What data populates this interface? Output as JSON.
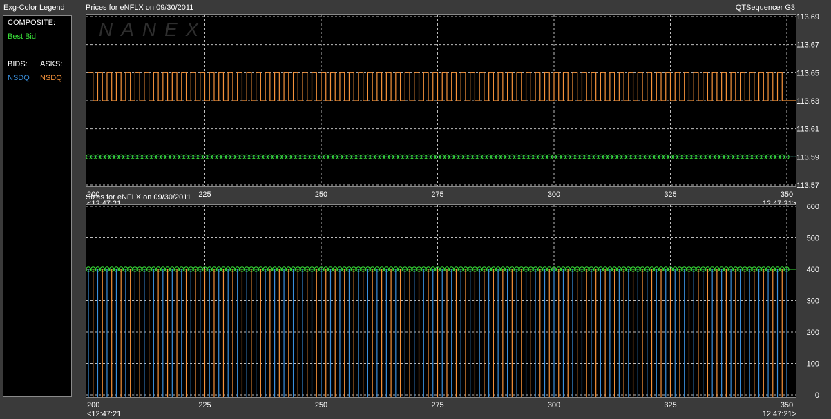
{
  "legend": {
    "title": "Exg-Color Legend",
    "composite_label": "COMPOSITE:",
    "best_bid_label": "Best Bid",
    "bids_label": "BIDS:",
    "asks_label": "ASKS:",
    "bid_exchange": "NSDQ",
    "ask_exchange": "NSDQ"
  },
  "app": {
    "name": "QTSequencer G3"
  },
  "watermark": "NANEX",
  "colors": {
    "bid": "#3a8fdc",
    "ask": "#f5923a",
    "best_bid": "#39e039",
    "grid": "#bdbdbd",
    "frame": "#8a8a8a"
  },
  "chart_data": [
    {
      "type": "line",
      "title": "Prices for  eNFLX  on  09/30/2011",
      "x_start_label": "<12:47:21",
      "x_end_label": "12:47:21>",
      "xlim": [
        200,
        350
      ],
      "x_ticks": [
        200,
        225,
        250,
        275,
        300,
        325,
        350
      ],
      "ylim": [
        113.57,
        113.69
      ],
      "y_ticks": [
        "113.57",
        "113.59",
        "113.61",
        "113.63",
        "113.65",
        "113.67",
        "113.69"
      ],
      "grid": true,
      "series": [
        {
          "name": "Best Bid",
          "pattern": "constant",
          "y": 113.59,
          "x_range": [
            200,
            350
          ],
          "markers": "circle"
        },
        {
          "name": "NSDQ",
          "side": "bid",
          "pattern": "constant",
          "y": 113.59,
          "x_range": [
            200,
            350
          ]
        },
        {
          "name": "NSDQ",
          "side": "ask",
          "pattern": "alternating",
          "values": [
            113.65,
            113.63
          ],
          "x_range": [
            200,
            350
          ],
          "final": 113.63
        }
      ]
    },
    {
      "type": "bar",
      "title": "Sizes for  eNFLX  on  09/30/2011",
      "x_start_label": "<12:47:21",
      "x_end_label": "12:47:21>",
      "xlim": [
        200,
        350
      ],
      "x_ticks": [
        200,
        225,
        250,
        275,
        300,
        325,
        350
      ],
      "ylim": [
        0,
        600
      ],
      "y_ticks": [
        "0",
        "100",
        "200",
        "300",
        "400",
        "500",
        "600"
      ],
      "grid": true,
      "series": [
        {
          "name": "Best Bid",
          "pattern": "constant",
          "y": 400,
          "x_range": [
            200,
            350
          ],
          "markers": "circle"
        },
        {
          "name": "NSDQ",
          "side": "bid",
          "pattern": "alternating",
          "values": [
            400,
            0
          ],
          "x_range": [
            200,
            350
          ]
        },
        {
          "name": "NSDQ",
          "side": "ask",
          "pattern": "alternating",
          "values": [
            0,
            400
          ],
          "x_range": [
            200,
            350
          ]
        }
      ]
    }
  ]
}
